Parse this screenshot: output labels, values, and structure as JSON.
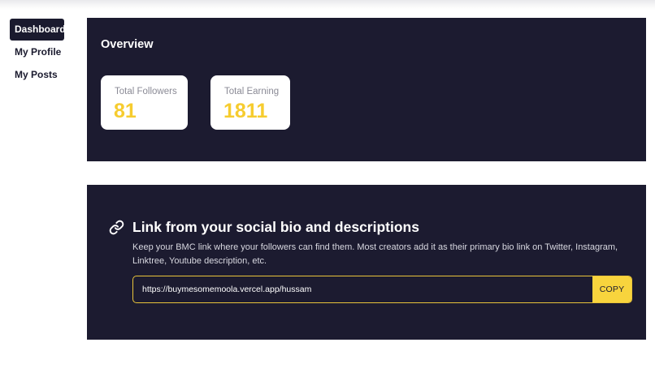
{
  "sidebar": {
    "items": [
      {
        "label": "Dashboard",
        "active": true
      },
      {
        "label": "My Profile",
        "active": false
      },
      {
        "label": "My Posts",
        "active": false
      }
    ]
  },
  "overview": {
    "title": "Overview",
    "stats": [
      {
        "label": "Total Followers",
        "value": "81"
      },
      {
        "label": "Total Earning",
        "value": "1811"
      }
    ]
  },
  "bio_link": {
    "icon": "link-icon",
    "title": "Link from your social bio and descriptions",
    "description": "Keep your BMC link where your followers can find them. Most creators add it as their primary bio link on Twitter, Instagram, Linktree, Youtube description, etc.",
    "url": "https://buymesomemoola.vercel.app/hussam",
    "copy_label": "COPY"
  },
  "colors": {
    "panel_bg": "#1c1b30",
    "accent": "#f6cc2f",
    "nav_active_bg": "#1a1a2e"
  }
}
